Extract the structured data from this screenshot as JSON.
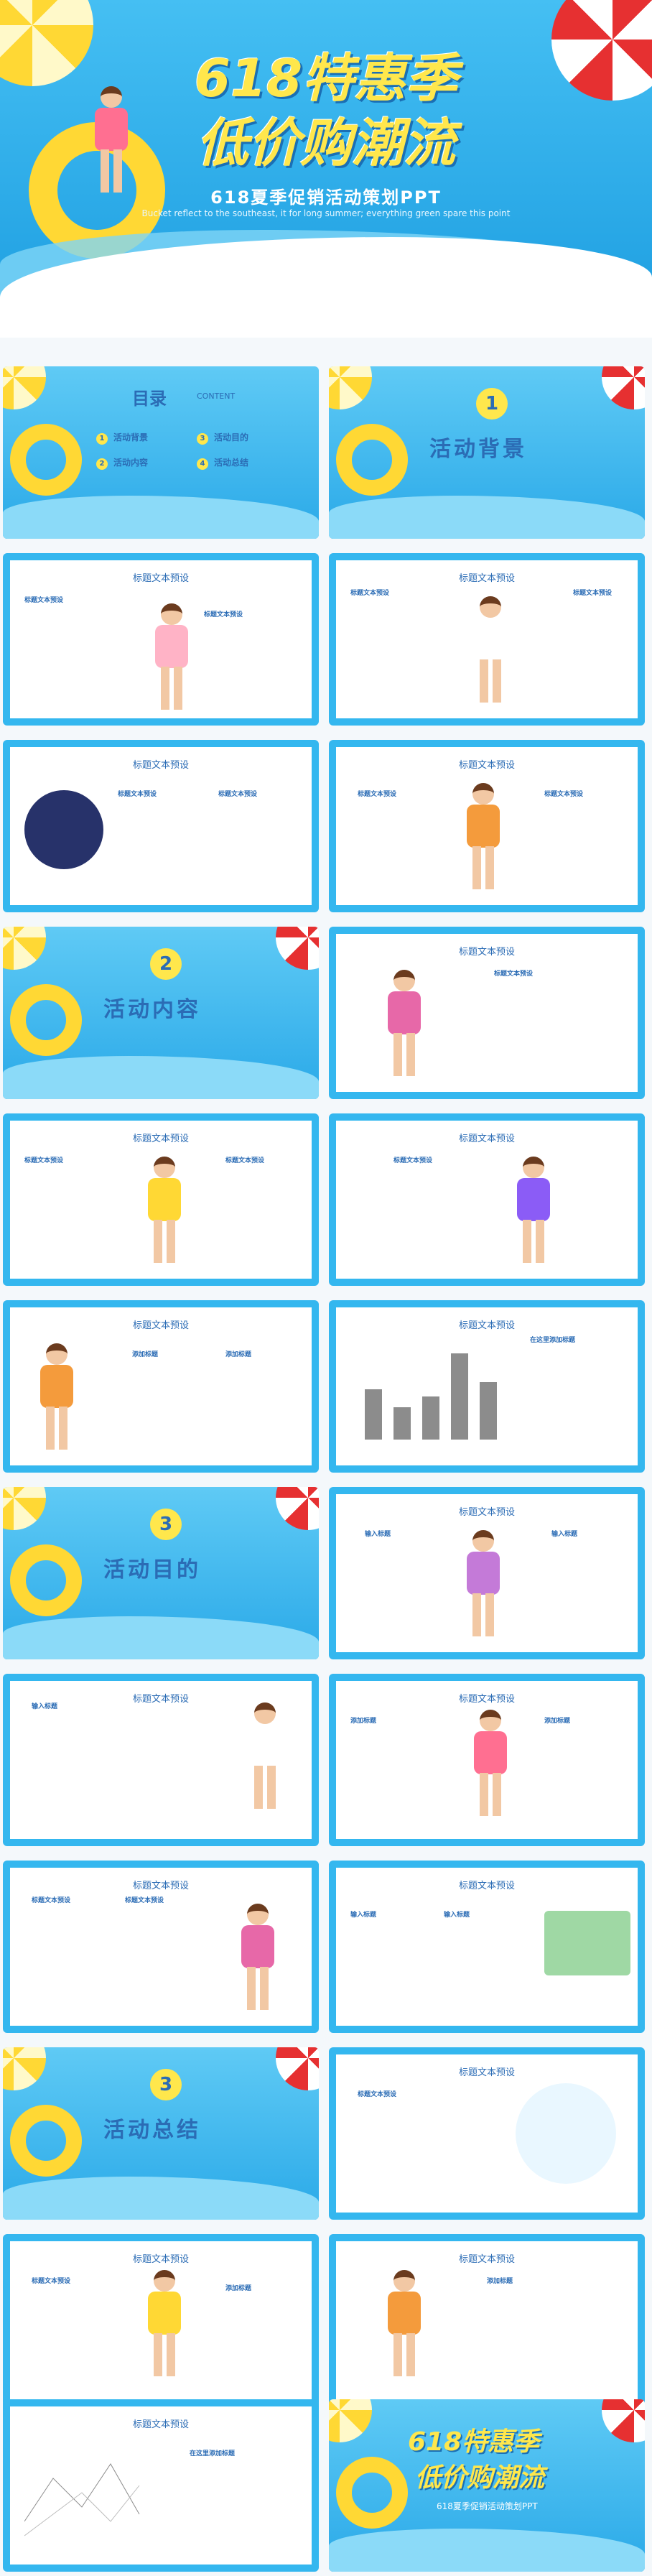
{
  "hero": {
    "title_line1": "618特惠季",
    "title_line2": "低价购潮流",
    "subtitle": "618夏季促销活动策划PPT",
    "tagline": "Bucket reflect to the southeast, it for long summer; everything green spare this point"
  },
  "toc": {
    "title": "目录",
    "title_en": "CONTENT",
    "items": [
      {
        "num": "1",
        "label": "活动背景"
      },
      {
        "num": "3",
        "label": "活动目的"
      },
      {
        "num": "2",
        "label": "活动内容"
      },
      {
        "num": "4",
        "label": "活动总结"
      }
    ]
  },
  "sections": [
    {
      "num": "1",
      "label": "活动背景"
    },
    {
      "num": "2",
      "label": "活动内容"
    },
    {
      "num": "3",
      "label": "活动目的"
    },
    {
      "num": "3",
      "label": "活动总结"
    }
  ],
  "slide_title": "标题文本预设",
  "slide_text": "标题文本预设",
  "input_title": "输入标题",
  "add_title": "添加标题",
  "add_here": "在这里添加标题",
  "final": {
    "title_line1": "618特惠季",
    "title_line2": "低价购潮流",
    "subtitle": "618夏季促销活动策划PPT"
  }
}
